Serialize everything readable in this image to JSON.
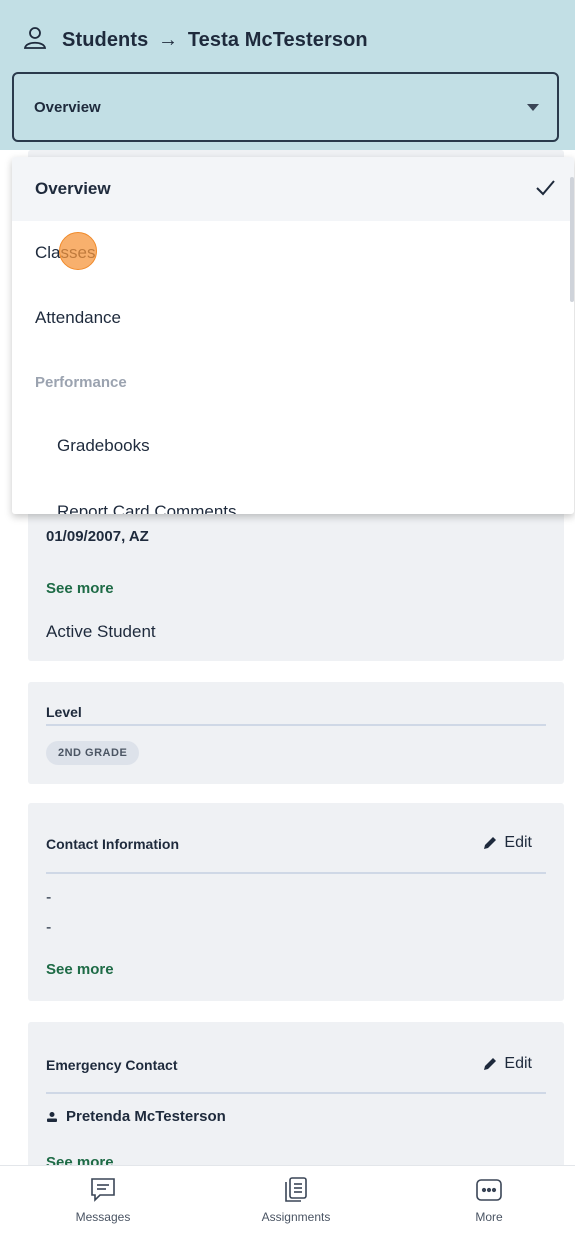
{
  "header": {
    "breadcrumb_root": "Students",
    "breadcrumb_arrow": "→",
    "breadcrumb_current": "Testa McTesterson",
    "select_value": "Overview"
  },
  "dropdown": {
    "items": [
      {
        "label": "Overview",
        "selected": true
      },
      {
        "label": "Classes"
      },
      {
        "label": "Attendance"
      },
      {
        "label": "Performance",
        "group_header": true
      },
      {
        "label": "Gradebooks",
        "indent": true
      },
      {
        "label": "Report Card Comments",
        "indent": true
      }
    ]
  },
  "cards": {
    "profile": {
      "dob_state": "01/09/2007, AZ",
      "see_more": "See more",
      "status": "Active Student"
    },
    "level": {
      "title": "Level",
      "badge": "2ND GRADE"
    },
    "contact": {
      "title": "Contact Information",
      "edit_label": "Edit",
      "line1": "-",
      "line2": "-",
      "see_more": "See more"
    },
    "emergency": {
      "title": "Emergency Contact",
      "edit_label": "Edit",
      "contact_name": "Pretenda McTesterson",
      "see_more": "See more"
    }
  },
  "bottom_nav": {
    "items": [
      {
        "label": "Messages",
        "icon": "messages-icon"
      },
      {
        "label": "Assignments",
        "icon": "assignments-icon"
      },
      {
        "label": "More",
        "icon": "more-icon"
      }
    ]
  },
  "colors": {
    "header_bg": "#c2dfe5",
    "accent_green": "#1e6b46",
    "card_bg": "#eff1f4",
    "touch_indicator": "#f5963c"
  }
}
